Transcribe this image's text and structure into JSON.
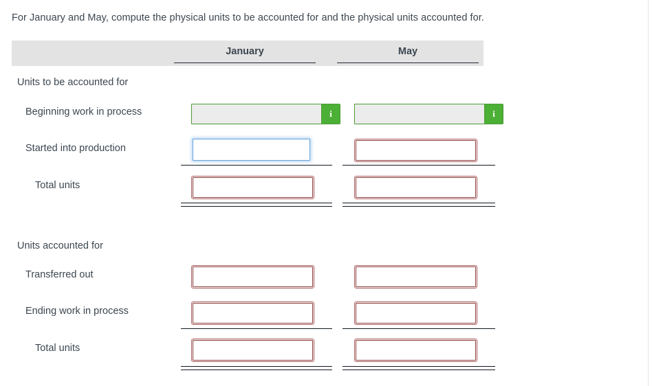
{
  "prompt": "For January and May, compute the physical units to be accounted for and the physical units accounted for.",
  "table": {
    "columns": [
      {
        "key": "january",
        "label": "January"
      },
      {
        "key": "may",
        "label": "May"
      }
    ],
    "sections": [
      {
        "heading": "Units to be accounted for",
        "rows": [
          {
            "label": "Beginning work in process",
            "indent": "item",
            "january": {
              "type": "locked",
              "value": "",
              "info_label": "i",
              "info_icon": "info-icon"
            },
            "may": {
              "type": "locked",
              "value": "",
              "info_label": "i",
              "info_icon": "info-icon"
            }
          },
          {
            "label": "Started into production",
            "indent": "item",
            "january": {
              "type": "focused",
              "value": ""
            },
            "may": {
              "type": "answer",
              "value": ""
            }
          },
          {
            "label": "Total units",
            "indent": "total",
            "january": {
              "type": "answer",
              "value": ""
            },
            "may": {
              "type": "answer",
              "value": ""
            }
          }
        ]
      },
      {
        "heading": "Units accounted for",
        "rows": [
          {
            "label": "Transferred out",
            "indent": "item",
            "january": {
              "type": "answer",
              "value": ""
            },
            "may": {
              "type": "answer",
              "value": ""
            }
          },
          {
            "label": "Ending work in process",
            "indent": "item",
            "january": {
              "type": "answer",
              "value": ""
            },
            "may": {
              "type": "answer",
              "value": ""
            }
          },
          {
            "label": "Total units",
            "indent": "total",
            "january": {
              "type": "answer",
              "value": ""
            },
            "may": {
              "type": "answer",
              "value": ""
            }
          }
        ]
      }
    ]
  },
  "colors": {
    "header_band": "#e3e3e3",
    "answer_border": "#8d3c3c",
    "focus_border": "#6aa4dd",
    "info_green": "#4caf36",
    "text": "#3c4650"
  }
}
